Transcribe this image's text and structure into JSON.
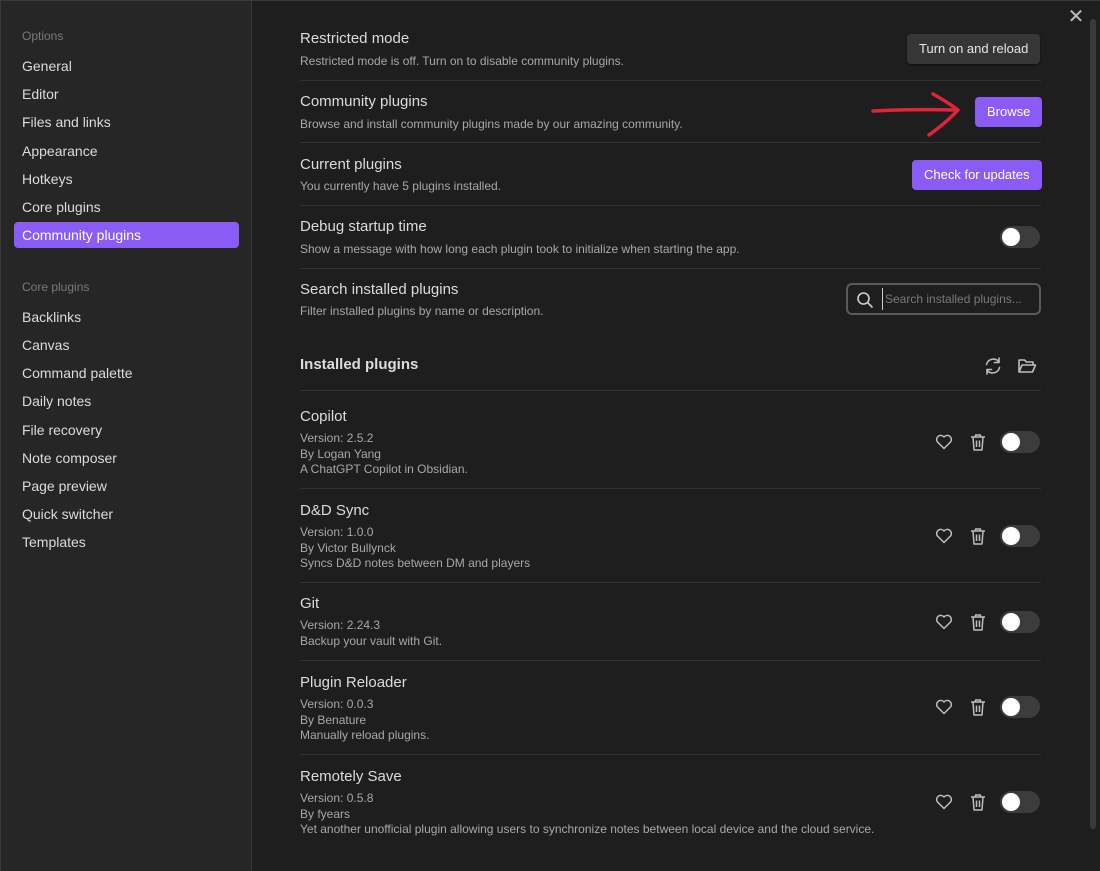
{
  "sidebar": {
    "options_header": "Options",
    "options": [
      "General",
      "Editor",
      "Files and links",
      "Appearance",
      "Hotkeys",
      "Core plugins",
      "Community plugins"
    ],
    "active_item": "Community plugins",
    "core_header": "Core plugins",
    "core_plugins": [
      "Backlinks",
      "Canvas",
      "Command palette",
      "Daily notes",
      "File recovery",
      "Note composer",
      "Page preview",
      "Quick switcher",
      "Templates"
    ]
  },
  "settings": {
    "restricted": {
      "name": "Restricted mode",
      "desc": "Restricted mode is off. Turn on to disable community plugins.",
      "button": "Turn on and reload"
    },
    "community": {
      "name": "Community plugins",
      "desc": "Browse and install community plugins made by our amazing community.",
      "button": "Browse"
    },
    "current": {
      "name": "Current plugins",
      "desc": "You currently have 5 plugins installed.",
      "button": "Check for updates"
    },
    "debug": {
      "name": "Debug startup time",
      "desc": "Show a message with how long each plugin took to initialize when starting the app.",
      "enabled": false
    },
    "search": {
      "name": "Search installed plugins",
      "desc": "Filter installed plugins by name or description.",
      "placeholder": "Search installed plugins..."
    }
  },
  "installed": {
    "title": "Installed plugins",
    "plugins": [
      {
        "name": "Copilot",
        "version": "Version: 2.5.2",
        "author": "By Logan Yang",
        "desc": "A ChatGPT Copilot in Obsidian.",
        "enabled": false
      },
      {
        "name": "D&D Sync",
        "version": "Version: 1.0.0",
        "author": "By Victor Bullynck",
        "desc": "Syncs D&D notes between DM and players",
        "enabled": false
      },
      {
        "name": "Git",
        "version": "Version: 2.24.3",
        "author": "",
        "desc": "Backup your vault with Git.",
        "enabled": false
      },
      {
        "name": "Plugin Reloader",
        "version": "Version: 0.0.3",
        "author": "By Benature",
        "desc": "Manually reload plugins.",
        "enabled": false
      },
      {
        "name": "Remotely Save",
        "version": "Version: 0.5.8",
        "author": "By fyears",
        "desc": "Yet another unofficial plugin allowing users to synchronize notes between local device and the cloud service.",
        "enabled": false
      }
    ]
  },
  "colors": {
    "accent": "#8a5cf5",
    "annotation_arrow": "#e0243a",
    "background": "#1e1e1e",
    "sidebar": "#262626"
  }
}
